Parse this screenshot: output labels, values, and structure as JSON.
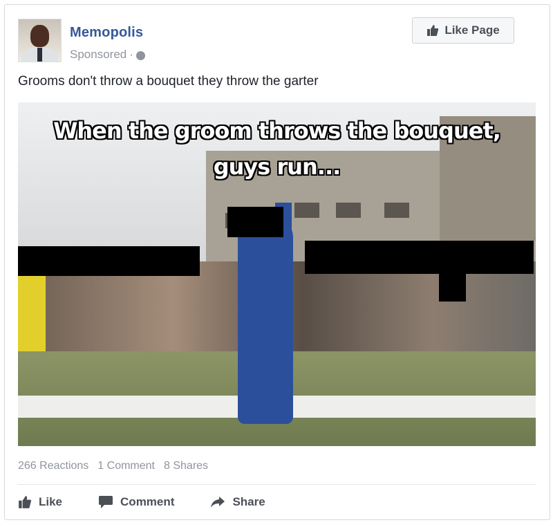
{
  "post": {
    "page_name": "Memopolis",
    "sponsored_label": "Sponsored",
    "separator": "·",
    "like_page_label": "Like Page",
    "text": "Grooms don't throw a bouquet they throw the garter",
    "image": {
      "caption_line1": "When the groom throws the bouquet,",
      "caption_line2": "guys run..."
    }
  },
  "stats": {
    "reactions": "266 Reactions",
    "comments": "1 Comment",
    "shares": "8 Shares"
  },
  "actions": {
    "like": "Like",
    "comment": "Comment",
    "share": "Share"
  },
  "colors": {
    "link": "#365899",
    "muted": "#90949c",
    "text": "#1d2129",
    "action": "#4b4f56"
  },
  "icons": {
    "like_page": "thumbs-up-icon",
    "globe": "globe-icon",
    "like": "thumbs-up-icon",
    "comment": "comment-bubble-icon",
    "share": "share-arrow-icon"
  }
}
